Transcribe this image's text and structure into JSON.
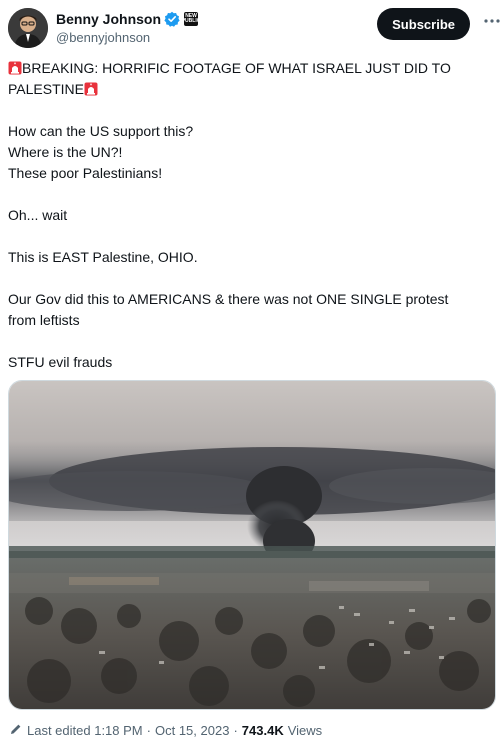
{
  "author": {
    "display_name": "Benny Johnson",
    "handle": "@bennyjohnson",
    "affiliate_badge": "NEW PUBLIC",
    "verified_color": "#1d9bf0"
  },
  "actions": {
    "subscribe_label": "Subscribe"
  },
  "tweet": {
    "line1": "BREAKING: HORRIFIC FOOTAGE OF WHAT ISRAEL JUST DID TO",
    "line2": "PALESTINE",
    "para2": [
      "How can the US support this?",
      "Where is the UN?!",
      "These poor Palestinians!"
    ],
    "para3": "Oh... wait",
    "para4": "This is EAST Palestine, OHIO.",
    "para5_line1": "Our Gov did this to AMERICANS & there was not ONE SINGLE protest",
    "para5_line2": "from leftists",
    "para6": "STFU evil frauds"
  },
  "meta": {
    "edited": "Last edited 1:18 PM",
    "sep1": "·",
    "date": "Oct 15, 2023",
    "sep2": "·",
    "views_count": "743.4K",
    "views_label": "Views"
  },
  "icons": {
    "siren": "siren-emoji-icon",
    "verified": "verified-badge-icon",
    "pencil": "pencil-icon",
    "more": "more-icon"
  }
}
